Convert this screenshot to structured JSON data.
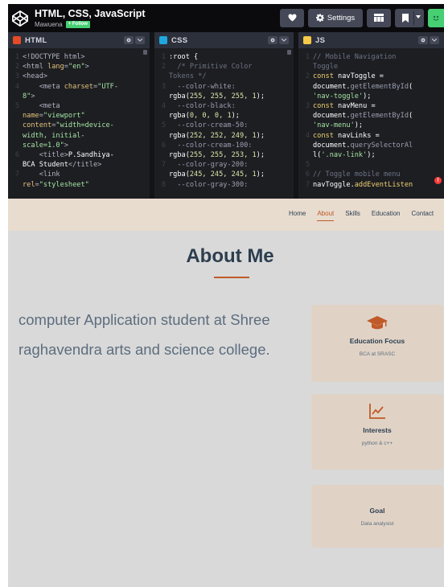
{
  "codepen": {
    "title": "HTML, CSS, JavaScript",
    "author": "Mawuena",
    "follow_label": "+ Follow",
    "settings_label": "Settings",
    "accent_color": "#47cf73"
  },
  "editors": {
    "html": {
      "label": "HTML",
      "badge_color": "#e34c26",
      "lines": [
        {
          "n": "1",
          "segs": [
            {
              "t": "<!DOCTYPE html>",
              "c": "tag"
            }
          ]
        },
        {
          "n": "2",
          "segs": [
            {
              "t": "<html ",
              "c": "tag"
            },
            {
              "t": "lang",
              "c": "attr"
            },
            {
              "t": "=",
              "c": "tag"
            },
            {
              "t": "\"en\"",
              "c": "str"
            },
            {
              "t": ">",
              "c": "tag"
            }
          ]
        },
        {
          "n": "3",
          "segs": [
            {
              "t": "<head>",
              "c": "tag"
            }
          ]
        },
        {
          "n": "4",
          "segs": [
            {
              "t": "    <meta ",
              "c": "tag"
            },
            {
              "t": "charset",
              "c": "attr"
            },
            {
              "t": "=",
              "c": "tag"
            },
            {
              "t": "\"UTF-",
              "c": "str"
            }
          ]
        },
        {
          "n": "",
          "segs": [
            {
              "t": "8\"",
              "c": "str"
            },
            {
              "t": ">",
              "c": "tag"
            }
          ]
        },
        {
          "n": "5",
          "segs": [
            {
              "t": "    <meta",
              "c": "tag"
            }
          ]
        },
        {
          "n": "",
          "segs": [
            {
              "t": "name",
              "c": "attr"
            },
            {
              "t": "=",
              "c": "tag"
            },
            {
              "t": "\"viewport\"",
              "c": "str"
            }
          ]
        },
        {
          "n": "",
          "segs": [
            {
              "t": "content",
              "c": "attr"
            },
            {
              "t": "=",
              "c": "tag"
            },
            {
              "t": "\"width=device-",
              "c": "str"
            }
          ]
        },
        {
          "n": "",
          "segs": [
            {
              "t": "width, initial-",
              "c": "str"
            }
          ]
        },
        {
          "n": "",
          "segs": [
            {
              "t": "scale=1.0\"",
              "c": "str"
            },
            {
              "t": ">",
              "c": "tag"
            }
          ]
        },
        {
          "n": "6",
          "segs": [
            {
              "t": "    <title>",
              "c": "tag"
            },
            {
              "t": "P.Sandhiya-",
              "c": "plain"
            }
          ]
        },
        {
          "n": "",
          "segs": [
            {
              "t": "BCA Student",
              "c": "plain"
            },
            {
              "t": "</title>",
              "c": "tag"
            }
          ]
        },
        {
          "n": "7",
          "segs": [
            {
              "t": "    <link",
              "c": "tag"
            }
          ]
        },
        {
          "n": "",
          "segs": [
            {
              "t": "rel",
              "c": "attr"
            },
            {
              "t": "=",
              "c": "tag"
            },
            {
              "t": "\"stylesheet\"",
              "c": "str"
            }
          ]
        }
      ]
    },
    "css": {
      "label": "CSS",
      "badge_color": "#1fa8e0",
      "lines": [
        {
          "n": "1",
          "segs": [
            {
              "t": ":root {",
              "c": "plain"
            }
          ]
        },
        {
          "n": "2",
          "segs": [
            {
              "t": "  /* Primitive Color",
              "c": "cmt"
            }
          ]
        },
        {
          "n": "",
          "segs": [
            {
              "t": "Tokens */",
              "c": "cmt"
            }
          ]
        },
        {
          "n": "3",
          "segs": [
            {
              "t": "  --color-white:",
              "c": "prop"
            }
          ]
        },
        {
          "n": "",
          "segs": [
            {
              "t": "rgba(",
              "c": "plain"
            },
            {
              "t": "255, 255, 255, 1",
              "c": "num"
            },
            {
              "t": ");",
              "c": "plain"
            }
          ]
        },
        {
          "n": "4",
          "segs": [
            {
              "t": "  --color-black:",
              "c": "prop"
            }
          ]
        },
        {
          "n": "",
          "segs": [
            {
              "t": "rgba(",
              "c": "plain"
            },
            {
              "t": "0, 0, 0, 1",
              "c": "num"
            },
            {
              "t": ");",
              "c": "plain"
            }
          ]
        },
        {
          "n": "5",
          "segs": [
            {
              "t": "  --color-cream-50:",
              "c": "prop"
            }
          ]
        },
        {
          "n": "",
          "segs": [
            {
              "t": "rgba(",
              "c": "plain"
            },
            {
              "t": "252, 252, 249, 1",
              "c": "num"
            },
            {
              "t": ");",
              "c": "plain"
            }
          ]
        },
        {
          "n": "6",
          "segs": [
            {
              "t": "  --color-cream-100:",
              "c": "prop"
            }
          ]
        },
        {
          "n": "",
          "segs": [
            {
              "t": "rgba(",
              "c": "plain"
            },
            {
              "t": "255, 255, 253, 1",
              "c": "num"
            },
            {
              "t": ");",
              "c": "plain"
            }
          ]
        },
        {
          "n": "7",
          "segs": [
            {
              "t": "  --color-gray-200:",
              "c": "prop"
            }
          ]
        },
        {
          "n": "",
          "segs": [
            {
              "t": "rgba(",
              "c": "plain"
            },
            {
              "t": "245, 245, 245, 1",
              "c": "num"
            },
            {
              "t": ");",
              "c": "plain"
            }
          ]
        },
        {
          "n": "8",
          "segs": [
            {
              "t": "  --color-gray-300:",
              "c": "prop"
            }
          ]
        }
      ]
    },
    "js": {
      "label": "JS",
      "badge_color": "#f7c948",
      "lines": [
        {
          "n": "1",
          "segs": [
            {
              "t": "// Mobile Navigation",
              "c": "cmt"
            }
          ]
        },
        {
          "n": "",
          "segs": [
            {
              "t": "Toggle",
              "c": "cmt"
            }
          ]
        },
        {
          "n": "2",
          "segs": [
            {
              "t": "const ",
              "c": "kw"
            },
            {
              "t": "navToggle =",
              "c": "plain"
            }
          ]
        },
        {
          "n": "",
          "segs": [
            {
              "t": "document.",
              "c": "plain"
            },
            {
              "t": "getElementById",
              "c": "prop"
            },
            {
              "t": "(",
              "c": "plain"
            }
          ]
        },
        {
          "n": "",
          "segs": [
            {
              "t": "'nav-toggle'",
              "c": "str"
            },
            {
              "t": ");",
              "c": "plain"
            }
          ]
        },
        {
          "n": "3",
          "segs": [
            {
              "t": "const ",
              "c": "kw"
            },
            {
              "t": "navMenu =",
              "c": "plain"
            }
          ]
        },
        {
          "n": "",
          "segs": [
            {
              "t": "document.",
              "c": "plain"
            },
            {
              "t": "getElementById",
              "c": "prop"
            },
            {
              "t": "(",
              "c": "plain"
            }
          ]
        },
        {
          "n": "",
          "segs": [
            {
              "t": "'nav-menu'",
              "c": "str"
            },
            {
              "t": ");",
              "c": "plain"
            }
          ]
        },
        {
          "n": "4",
          "segs": [
            {
              "t": "const ",
              "c": "kw"
            },
            {
              "t": "navLinks =",
              "c": "plain"
            }
          ]
        },
        {
          "n": "",
          "segs": [
            {
              "t": "document.",
              "c": "plain"
            },
            {
              "t": "querySelectorAl",
              "c": "prop"
            }
          ]
        },
        {
          "n": "",
          "segs": [
            {
              "t": "l(",
              "c": "plain"
            },
            {
              "t": "'.nav-link'",
              "c": "str"
            },
            {
              "t": ");",
              "c": "plain"
            }
          ]
        },
        {
          "n": "5",
          "segs": [
            {
              "t": "",
              "c": "plain"
            }
          ]
        },
        {
          "n": "6",
          "segs": [
            {
              "t": "// Toggle mobile menu",
              "c": "cmt"
            }
          ]
        },
        {
          "n": "7",
          "segs": [
            {
              "t": "navToggle.",
              "c": "plain"
            },
            {
              "t": "addEventListen",
              "c": "fn"
            }
          ]
        }
      ],
      "error_count": "!"
    }
  },
  "preview": {
    "nav": [
      {
        "label": "Home",
        "active": false
      },
      {
        "label": "About",
        "active": true
      },
      {
        "label": "Skills",
        "active": false
      },
      {
        "label": "Education",
        "active": false
      },
      {
        "label": "Contact",
        "active": false
      }
    ],
    "heading": "About Me",
    "accent_color": "#c05a28",
    "intro": "computer Application student at Shree raghavendra arts and science college.",
    "cards": [
      {
        "icon": "graduation-cap-icon",
        "title": "Education Focus",
        "desc": "BCA at SRASC"
      },
      {
        "icon": "trend-chart-icon",
        "title": "Interests",
        "desc": "python & c++"
      },
      {
        "icon": "",
        "title": "Goal",
        "desc": "Data analysist"
      }
    ]
  }
}
